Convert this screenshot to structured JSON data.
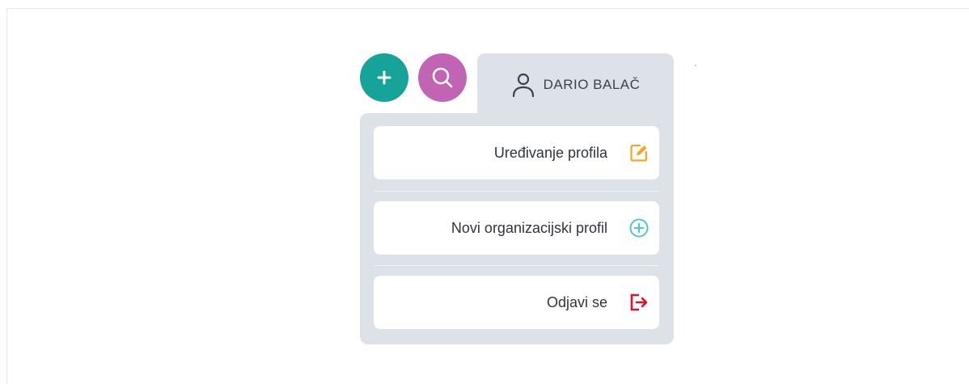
{
  "header": {
    "add_button_icon": "plus-icon",
    "search_button_icon": "search-icon",
    "user_icon": "user-icon",
    "user_name": "DARIO BALAČ"
  },
  "menu": {
    "items": [
      {
        "label": "Uređivanje profila",
        "icon": "edit-icon",
        "icon_color": "#f5a623"
      },
      {
        "label": "Novi organizacijski profil",
        "icon": "plus-circle-icon",
        "icon_color": "#4fc8d3"
      },
      {
        "label": "Odjavi se",
        "icon": "logout-icon",
        "icon_color": "#e0102a"
      }
    ]
  },
  "colors": {
    "add_button": "#16a39a",
    "search_button": "#c164b4",
    "panel_background": "#dde2e9"
  }
}
